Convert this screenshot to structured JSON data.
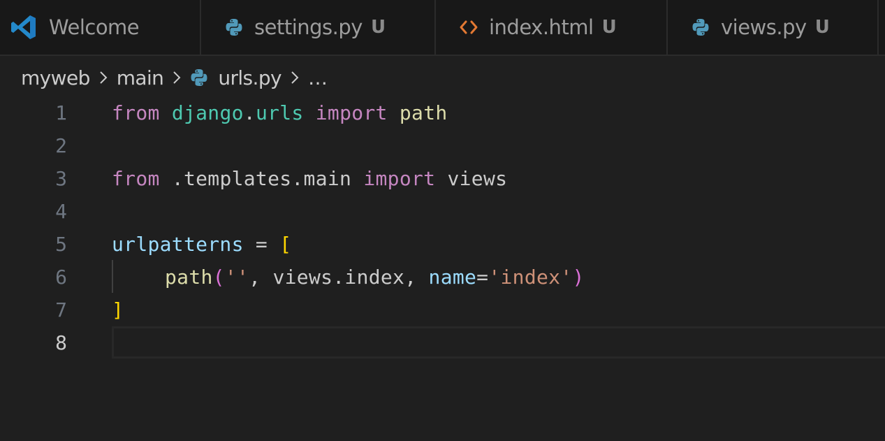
{
  "tabs": [
    {
      "label": "Welcome",
      "icon": "vscode-icon",
      "status": ""
    },
    {
      "label": "settings.py",
      "icon": "python-icon",
      "status": "U"
    },
    {
      "label": "index.html",
      "icon": "html-icon",
      "status": "U"
    },
    {
      "label": "views.py",
      "icon": "python-icon",
      "status": "U"
    }
  ],
  "breadcrumb": {
    "items": [
      "myweb",
      "main",
      "urls.py",
      "..."
    ],
    "ellipsis": "…"
  },
  "editor": {
    "active_line": 8,
    "line_numbers": [
      "1",
      "2",
      "3",
      "4",
      "5",
      "6",
      "7",
      "8"
    ],
    "line1": {
      "kw1": "from",
      "mod1": "django",
      "dot": ".",
      "mod2": "urls",
      "kw2": "import",
      "name": "path"
    },
    "line3": {
      "kw1": "from",
      "module": ".templates.main",
      "kw2": "import",
      "name": "views"
    },
    "line5": {
      "var": "urlpatterns",
      "op": " = ",
      "open": "["
    },
    "line6": {
      "fn": "path",
      "open": "(",
      "str1": "''",
      "sep1": ", ",
      "arg": "views.index",
      "sep2": ", ",
      "kwarg": "name",
      "eq": "=",
      "str2": "'index'",
      "close": ")"
    },
    "line7": {
      "close": "]"
    }
  },
  "colors": {
    "background": "#1f1f1f",
    "tabbar": "#181818",
    "keyword": "#c586c0",
    "module": "#4ec9b0",
    "function": "#dcdcaa",
    "variable": "#9cdcfe",
    "string": "#ce9178",
    "bracket": "#ffd700",
    "python_icon": "#519aba",
    "html_icon": "#e37933",
    "vscode_icon": "#2489ca"
  }
}
